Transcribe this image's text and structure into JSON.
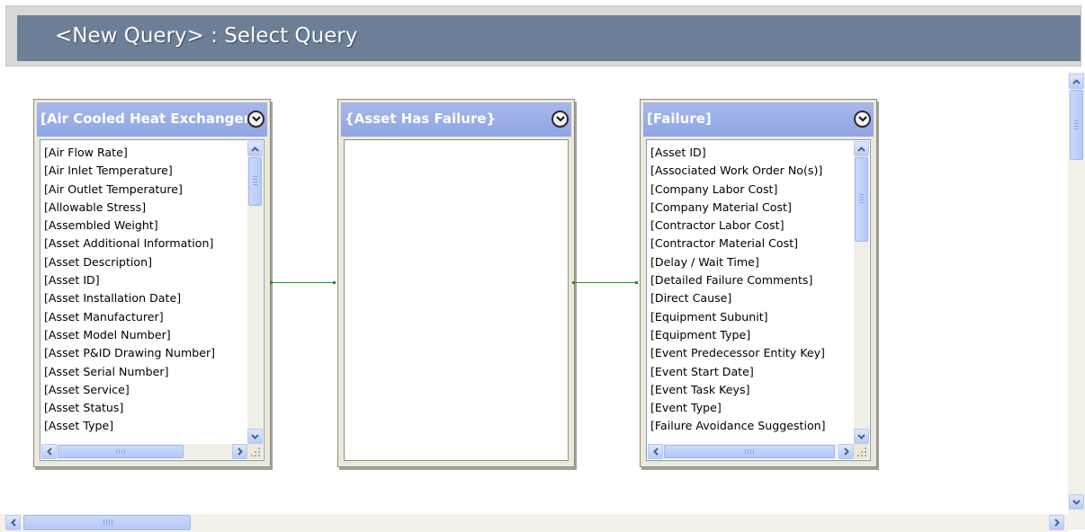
{
  "window": {
    "title": "<New Query> : Select Query"
  },
  "tables": [
    {
      "title": "[Air Cooled Heat Exchanger]",
      "fields": [
        "[Air Flow Rate]",
        "[Air Inlet Temperature]",
        "[Air Outlet Temperature]",
        "[Allowable Stress]",
        "[Assembled Weight]",
        "[Asset Additional Information]",
        "[Asset Description]",
        "[Asset ID]",
        "[Asset Installation Date]",
        "[Asset Manufacturer]",
        "[Asset Model Number]",
        "[Asset P&ID Drawing Number]",
        "[Asset Serial Number]",
        "[Asset Service]",
        "[Asset Status]",
        "[Asset Type]"
      ]
    },
    {
      "title": "{Asset Has Failure}",
      "fields": []
    },
    {
      "title": "[Failure]",
      "fields": [
        "[Asset ID]",
        "[Associated Work Order No(s)]",
        "[Company Labor Cost]",
        "[Company Material Cost]",
        "[Contractor Labor Cost]",
        "[Contractor Material Cost]",
        "[Delay / Wait Time]",
        "[Detailed Failure Comments]",
        "[Direct Cause]",
        "[Equipment Subunit]",
        "[Equipment Type]",
        "[Event Predecessor Entity Key]",
        "[Event Start Date]",
        "[Event Task Keys]",
        "[Event Type]",
        "[Failure Avoidance Suggestion]"
      ]
    }
  ],
  "icons": {
    "dropdown": "chevron-down-circle-icon",
    "scroll_up": "arrow-up-icon",
    "scroll_down": "arrow-down-icon",
    "scroll_left": "arrow-left-icon",
    "scroll_right": "arrow-right-icon",
    "resize": "resize-grip-icon"
  },
  "colors": {
    "title_bar": "#6c7f97",
    "table_header": "#8fa5e4",
    "connector": "#2e8b2e"
  }
}
